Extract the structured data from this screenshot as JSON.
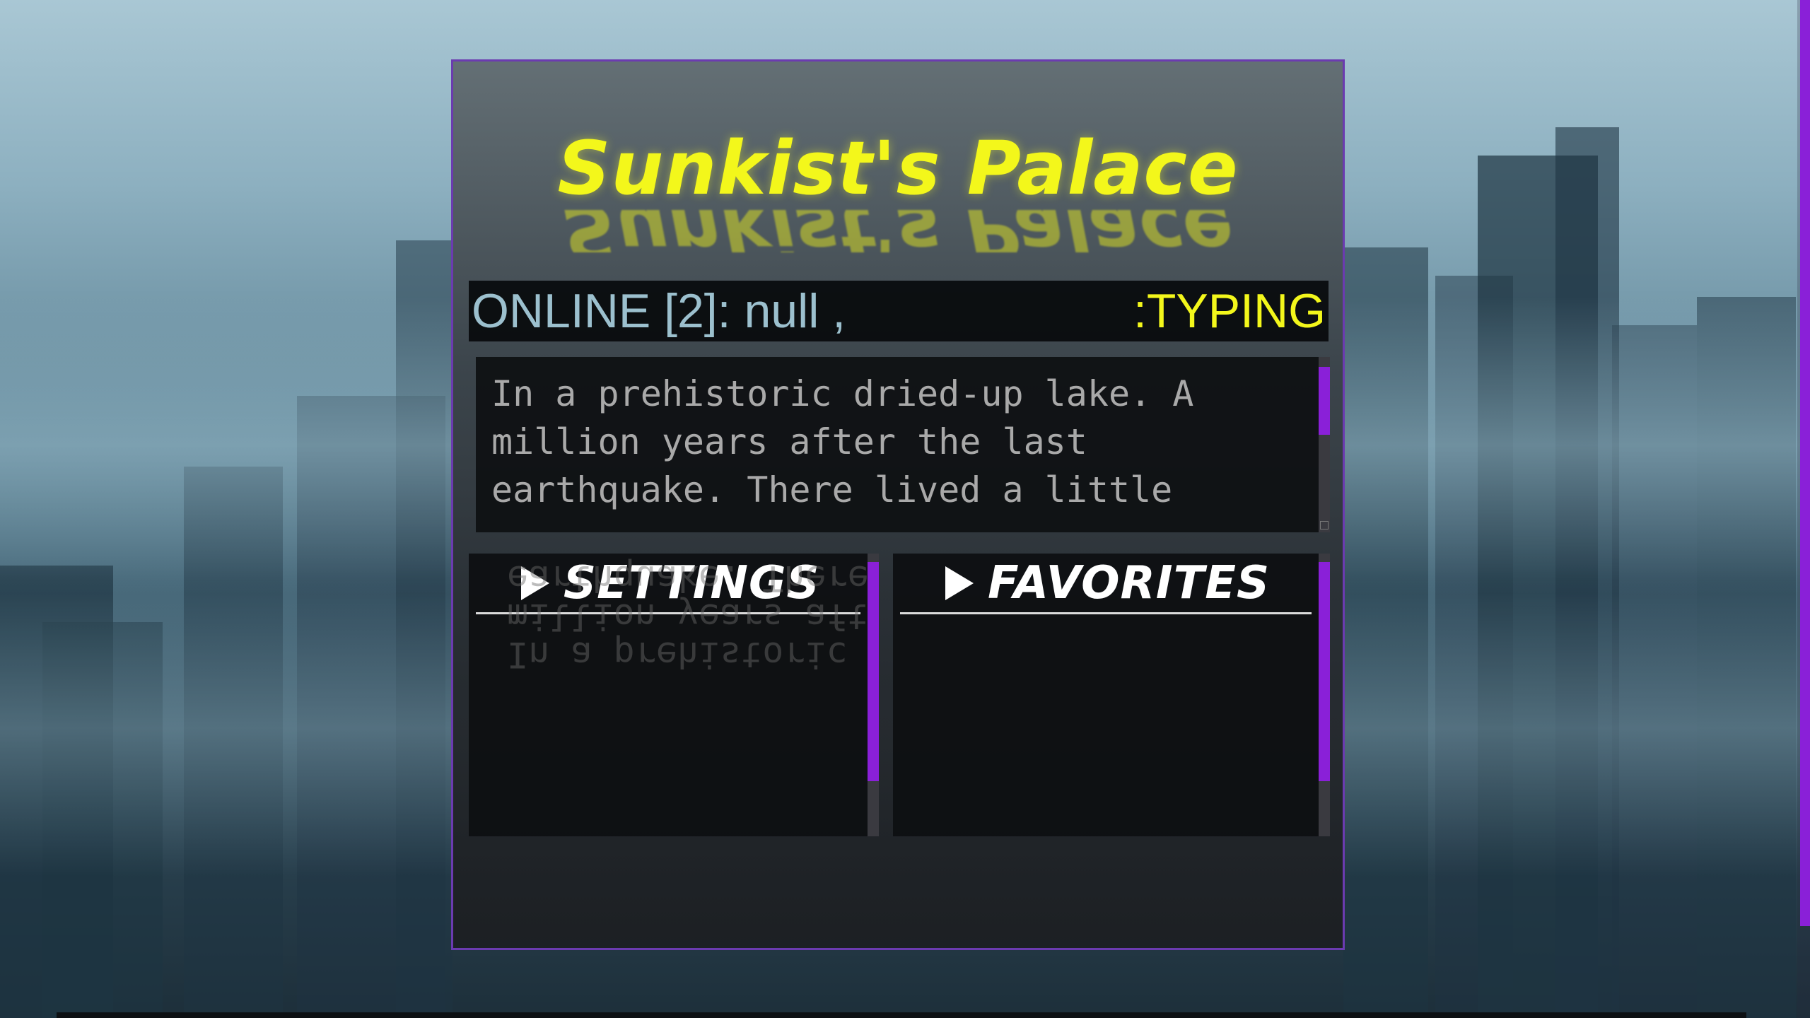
{
  "app": {
    "title": "Sunkist's Palace"
  },
  "status": {
    "online_label": "ONLINE [2]: null ,",
    "typing_label": ":TYPING"
  },
  "message": {
    "text": "In a prehistoric dried-up lake. A\nmillion years after the last\nearthquake. There lived a little"
  },
  "menus": {
    "settings_label": "SETTINGS",
    "favorites_label": "FAVORITES"
  },
  "reflection": {
    "line1": "earthquake. There lived a little",
    "line2": "million years after the last",
    "line3": "In a prehistoric dried-up lake. A"
  },
  "colors": {
    "accent": "#8a20d8",
    "title": "#f3f71b",
    "online": "#9cc0ce",
    "border": "#6b3bb0"
  }
}
